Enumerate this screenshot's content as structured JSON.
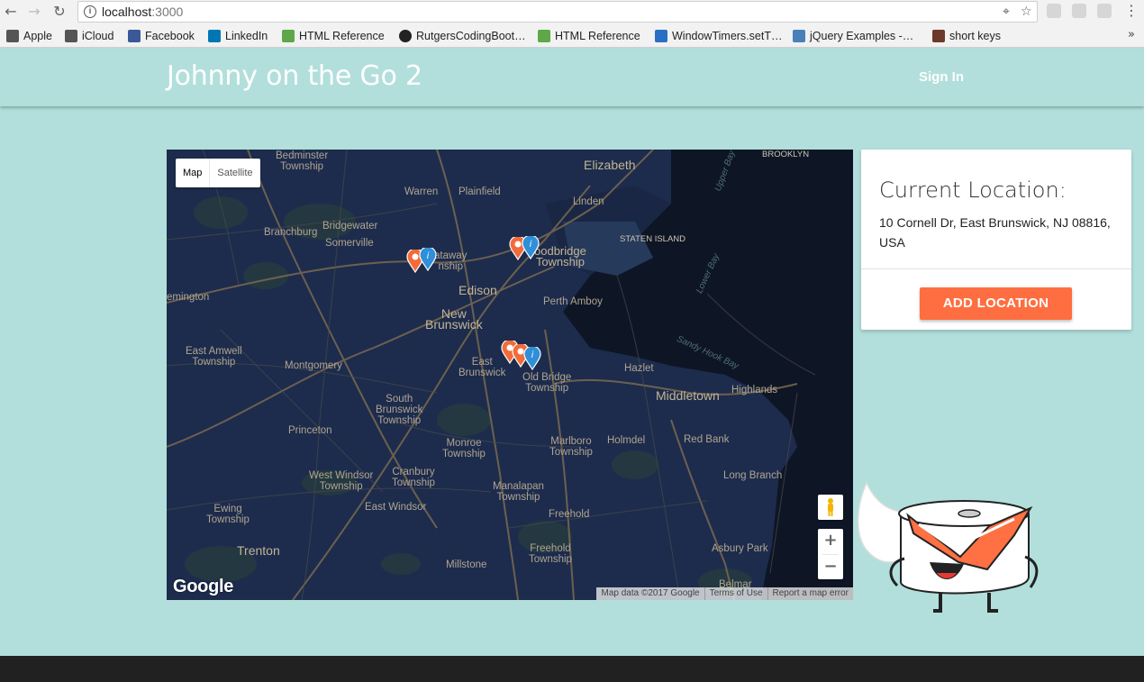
{
  "browser": {
    "url_host": "localhost",
    "url_port": ":3000",
    "bookmarks": [
      {
        "label": "Apple",
        "color": "#555555"
      },
      {
        "label": "iCloud",
        "color": "#555555"
      },
      {
        "label": "Facebook",
        "color": "#3b5998"
      },
      {
        "label": "LinkedIn",
        "color": "#0077b5"
      },
      {
        "label": "HTML Reference",
        "color": "#5fa84a"
      },
      {
        "label": "RutgersCodingBoot…",
        "color": "#222222"
      },
      {
        "label": "HTML Reference",
        "color": "#5fa84a"
      },
      {
        "label": "WindowTimers.setT…",
        "color": "#2b6fc4"
      },
      {
        "label": "jQuery Examples -…",
        "color": "#4a80b8"
      },
      {
        "label": "short keys",
        "color": "#6b3a2a"
      }
    ],
    "more": "»"
  },
  "nav": {
    "brand": "Johnny on the Go 2",
    "sign_in": "Sign In"
  },
  "map": {
    "type_map": "Map",
    "type_satellite": "Satellite",
    "logo": "Google",
    "footer": {
      "data": "Map data ©2017 Google",
      "terms": "Terms of Use",
      "report": "Report a map error"
    },
    "zoom_in": "+",
    "zoom_out": "−",
    "labels": {
      "bedminster": "Bedminster\nTownship",
      "elizabeth": "Elizabeth",
      "brooklyn": "BROOKLYN",
      "warren": "Warren",
      "plainfield": "Plainfield",
      "linden": "Linden",
      "upper_bay": "Upper Bay",
      "bridgewater": "Bridgewater",
      "branchburg": "Branchburg",
      "somerville": "Somerville",
      "staten_island": "STATEN ISLAND",
      "piscataway": "ataway\nnship",
      "woodbridge": "oodbridge\nTownship",
      "lower_bay": "Lower Bay",
      "edison": "Edison",
      "perth_amboy": "Perth Amboy",
      "flemington": "emington",
      "new_brunswick": "New\nBrunswick",
      "east_amwell": "East Amwell\nTownship",
      "montgomery": "Montgomery",
      "east_brunswick": "East\nBrunswick",
      "old_bridge": "Old Bridge\nTownship",
      "sandy_hook_bay": "Sandy Hook Bay",
      "hazlet": "Hazlet",
      "middletown": "Middletown",
      "highlands": "Highlands",
      "south_brunswick": "South\nBrunswick\nTownship",
      "princeton": "Princeton",
      "monroe": "Monroe\nTownship",
      "marlboro": "Marlboro\nTownship",
      "holmdel": "Holmdel",
      "red_bank": "Red Bank",
      "cranbury": "Cranbury\nTownship",
      "west_windsor": "West Windsor\nTownship",
      "manalapan": "Manalapan\nTownship",
      "long_branch": "Long Branch",
      "ewing": "Ewing\nTownship",
      "east_windsor": "East Windsor",
      "freehold": "Freehold",
      "trenton": "Trenton",
      "freehold_twp": "Freehold\nTownship",
      "asbury_park": "Asbury Park",
      "millstone": "Millstone",
      "belmar": "Belmar"
    }
  },
  "card": {
    "title": "Current Location:",
    "address": "10 Cornell Dr, East Brunswick, NJ 08816, USA",
    "button": "ADD LOCATION"
  },
  "colors": {
    "page_bg": "#b2dfdb",
    "map_bg": "#1d2c4d",
    "button": "#ff6e40",
    "footer": "#212121"
  }
}
